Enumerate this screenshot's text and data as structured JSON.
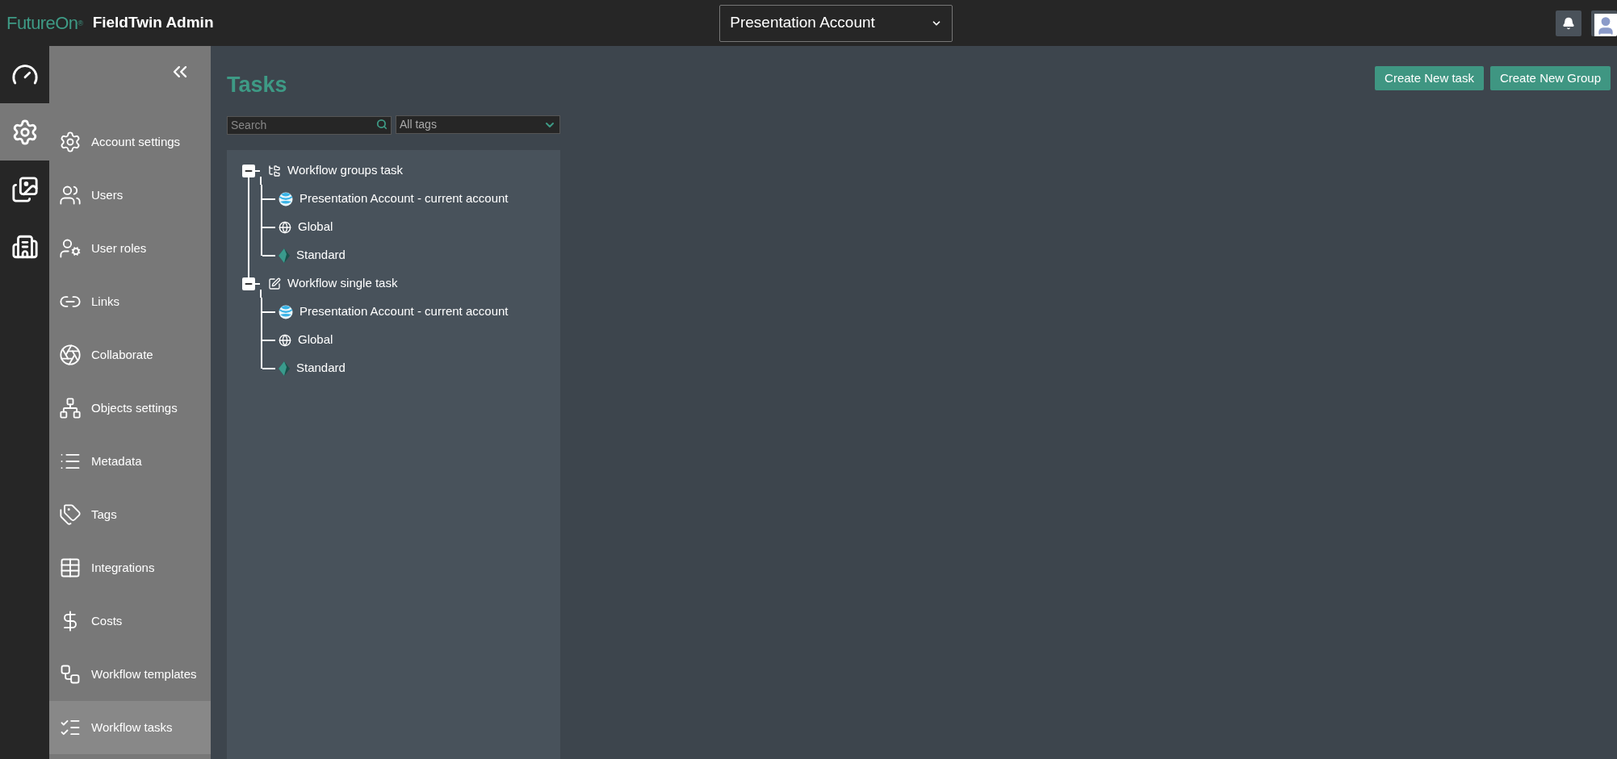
{
  "header": {
    "logo": "FutureOn",
    "registered": "®",
    "title": "FieldTwin Admin",
    "account_select": {
      "value": "Presentation Account"
    }
  },
  "rail": [
    {
      "kind": "dashboard",
      "selected": false
    },
    {
      "kind": "settings",
      "selected": true
    },
    {
      "kind": "gallery",
      "selected": false
    },
    {
      "kind": "building",
      "selected": false
    }
  ],
  "sidebar": {
    "items": [
      {
        "kind": "gear",
        "label": "Account settings",
        "selected": false
      },
      {
        "kind": "users",
        "label": "Users",
        "selected": false
      },
      {
        "kind": "user-gear",
        "label": "User roles",
        "selected": false
      },
      {
        "kind": "link",
        "label": "Links",
        "selected": false
      },
      {
        "kind": "collab",
        "label": "Collaborate",
        "selected": false
      },
      {
        "kind": "network",
        "label": "Objects settings",
        "selected": false
      },
      {
        "kind": "list",
        "label": "Metadata",
        "selected": false
      },
      {
        "kind": "tags",
        "label": "Tags",
        "selected": false
      },
      {
        "kind": "table",
        "label": "Integrations",
        "selected": false
      },
      {
        "kind": "dollar",
        "label": "Costs",
        "selected": false
      },
      {
        "kind": "flow",
        "label": "Workflow templates",
        "selected": false
      },
      {
        "kind": "tasks",
        "label": "Workflow tasks",
        "selected": true
      }
    ]
  },
  "page": {
    "title": "Tasks",
    "buttons": [
      "Create New task",
      "Create New Group"
    ],
    "search": {
      "placeholder": "Search"
    },
    "tags_filter": {
      "value": "All tags"
    },
    "tree": [
      {
        "kind": "group",
        "label": "Workflow groups task",
        "expanded": true,
        "children": [
          {
            "kind": "account",
            "label": "Presentation Account - current account"
          },
          {
            "kind": "global",
            "label": "Global"
          },
          {
            "kind": "standard",
            "label": "Standard"
          }
        ]
      },
      {
        "kind": "single",
        "label": "Workflow single task",
        "expanded": true,
        "children": [
          {
            "kind": "account",
            "label": "Presentation Account - current account"
          },
          {
            "kind": "global",
            "label": "Global"
          },
          {
            "kind": "standard",
            "label": "Standard"
          }
        ]
      }
    ]
  }
}
